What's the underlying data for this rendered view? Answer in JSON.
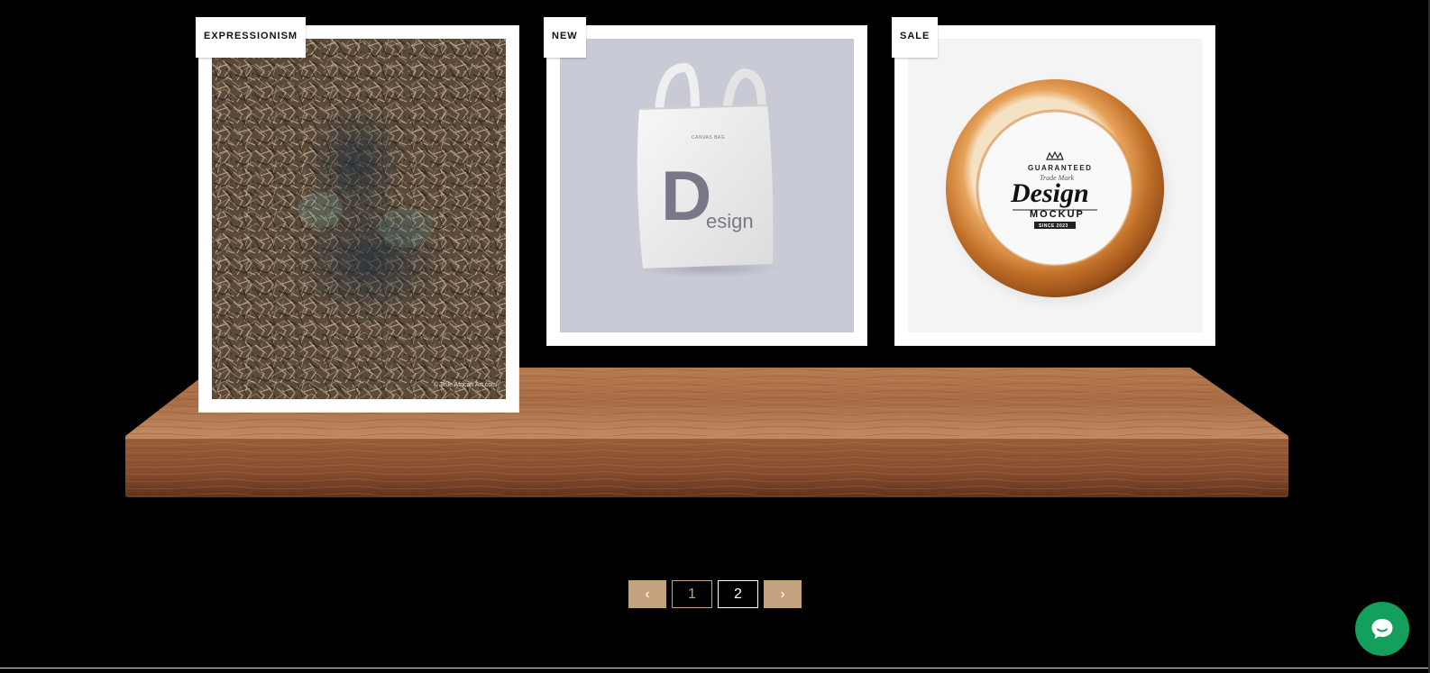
{
  "products": [
    {
      "badge": "EXPRESSIONISM",
      "art": "abstract-expressionism-painting",
      "watermark": "© True African Art.com"
    },
    {
      "badge": "NEW",
      "art": "canvas-tote-bag-mockup",
      "bag_text": "CANVAS BAG",
      "logo_letter": "D",
      "logo_rest": "esign"
    },
    {
      "badge": "SALE",
      "art": "wooden-plate-logo-mockup",
      "plate_top": "GUARANTEED",
      "plate_script": "Trade Mark",
      "plate_title": "Design",
      "plate_sub": "MOCKUP",
      "plate_since": "SINCE 2023"
    }
  ],
  "pagination": {
    "prev_label": "‹",
    "pages": [
      "1",
      "2"
    ],
    "current": "2",
    "next_label": "›"
  },
  "colors": {
    "accent": "#c5a27e",
    "background": "#000000",
    "chat": "#13a05c"
  },
  "chat": {
    "icon": "chat-bubble-icon"
  }
}
